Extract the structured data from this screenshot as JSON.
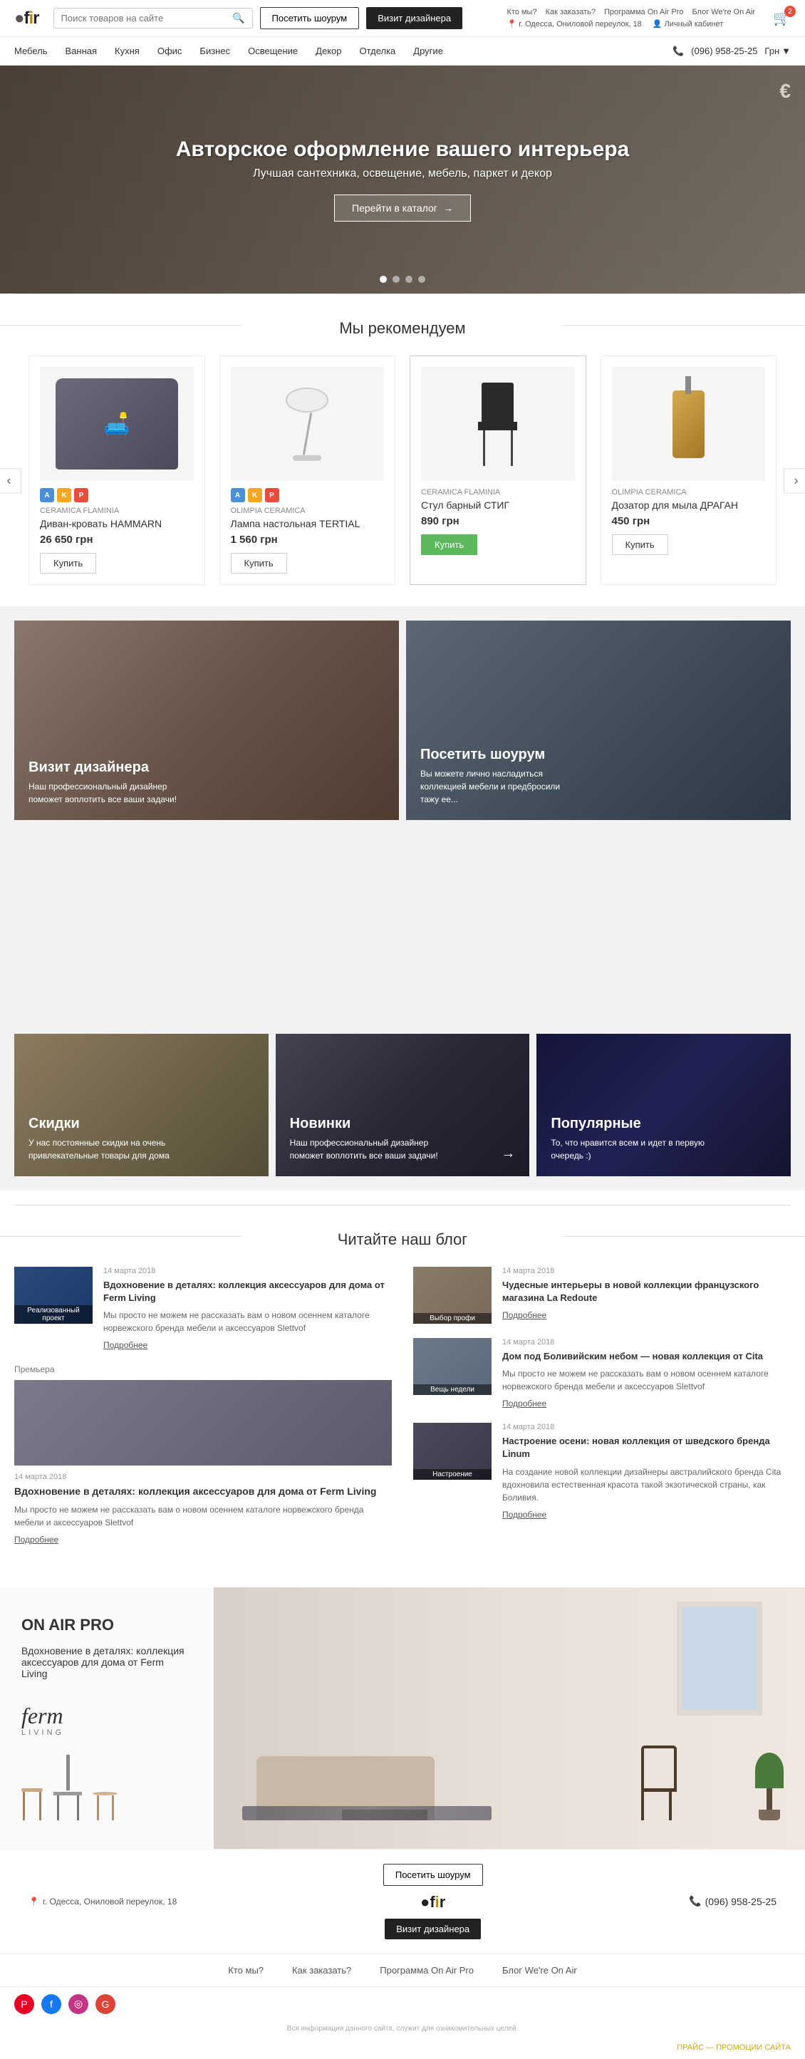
{
  "header": {
    "logo": "efir",
    "search_placeholder": "Поиск товаров на сайте",
    "btn_visit_showroom": "Посетить шоурум",
    "btn_visit_designer": "Визит дизайнера",
    "address": "г. Одесса, Ониловой переулок, 18",
    "personal_cabinet": "Личный кабинет",
    "cart_count": "2",
    "info_links": {
      "who_we_are": "Кто мы?",
      "how_to_order": "Как заказать?",
      "program": "Программа On Air Pro",
      "blog": "Блог We're On Air"
    }
  },
  "nav": {
    "items": [
      {
        "label": "Мебель"
      },
      {
        "label": "Ванная"
      },
      {
        "label": "Кухня"
      },
      {
        "label": "Офис"
      },
      {
        "label": "Бизнес"
      },
      {
        "label": "Освещение"
      },
      {
        "label": "Декор"
      },
      {
        "label": "Отделка"
      },
      {
        "label": "Другие"
      }
    ],
    "phone": "(096) 958-25-25",
    "currency": "Грн"
  },
  "hero": {
    "title": "Авторское оформление вашего интерьера",
    "subtitle": "Лучшая сантехника, освещение, мебель, паркет и декор",
    "btn_catalog": "Перейти в каталог",
    "watermark": "€",
    "dots": 4
  },
  "recommended": {
    "section_title": "Мы рекомендуем",
    "products": [
      {
        "brand": "CERAMICA FLAMINIA",
        "name": "Диван-кровать HAMMARN",
        "price": "26 650 грн",
        "btn": "Купить",
        "badges": [
          "A",
          "K",
          "P"
        ]
      },
      {
        "brand": "Olimpia Ceramica",
        "name": "Лампа настольная TERTIAL",
        "price": "1 560 грн",
        "btn": "Купить",
        "badges": [
          "A",
          "K",
          "P"
        ]
      },
      {
        "brand": "CERAMICA FLAMINIA",
        "name": "Стул барный СТИГ",
        "price": "890 грн",
        "btn": "Купить",
        "btn_style": "green",
        "badges": []
      },
      {
        "brand": "Olimpia Ceramica",
        "name": "Дозатор для мыла ДРАГАН",
        "price": "450 грн",
        "btn": "Купить",
        "badges": []
      }
    ]
  },
  "promo": {
    "cards_main": [
      {
        "title": "Визит дизайнера",
        "desc": "Наш профессиональный дизайнер поможет воплотить все ваши задачи!"
      },
      {
        "title": "Посетить шоурум",
        "desc": "Вы можете лично насладиться коллекцией мебели и предбросили тажу ее..."
      }
    ],
    "cards_bottom": [
      {
        "title": "Скидки",
        "desc": "У нас постоянные скидки на очень привлекательные товары для дома"
      },
      {
        "title": "Новинки",
        "desc": "Наш профессиональный дизайнер поможет воплотить все ваши задачи!",
        "has_arrow": true
      },
      {
        "title": "Популярные",
        "desc": "То, что нравится всем и идет в первую очередь :)"
      }
    ]
  },
  "blog": {
    "section_title": "Читайте наш блог",
    "posts": [
      {
        "date": "14 марта 2018",
        "title": "Вдохновение в деталях: коллекция аксессуаров для дома от Ferm Living",
        "excerpt": "Мы просто не можем не рассказать вам о новом осеннем каталоге норвежского бренда мебели и аксессуаров Slettvof",
        "more": "Подробнее",
        "tag": "Реализованный проект",
        "img_class": "bi-1"
      },
      {
        "date": "14 марта 2018",
        "title": "Чудесные интерьеры в новой коллекции французского магазина La Redoute",
        "excerpt": "",
        "more": "Подробнее",
        "tag": "Выбор профи",
        "img_class": "bi-2"
      },
      {
        "date": "14 марта 2018",
        "title": "Дом под Боливийским небом — новая коллекция от Cita",
        "excerpt": "Мы просто не можем не рассказать вам о новом осеннем каталоге норвежского бренда мебели и аксессуаров Slettvof",
        "more": "Подробнее",
        "tag": "Вещь недели",
        "img_class": "bi-3"
      },
      {
        "date": "14 марта 2018",
        "title": "Настроение осени: новая коллекция от шведского бренда Linum",
        "excerpt": "На создание новой коллекции дизайнеры австралийского бренда Cita вдохновила естественная красота такой экзотической страны, как Боливия.",
        "more": "Подробнее",
        "tag": "Настроение",
        "img_class": "bi-4"
      }
    ],
    "featured": {
      "date": "14 марта 2018",
      "title": "Вдохновение в деталях: коллекция аксессуаров для дома от Ferm Living",
      "excerpt": "Мы просто не можем не рассказать вам о новом осеннем каталоге норвежского бренда мебели и аксессуаров Slettvof",
      "more": "Подробнее",
      "tag": "Премьера",
      "img_class": "bi-5"
    }
  },
  "on_air_pro": {
    "section_tag": "ON AIR PRO",
    "subtitle": "Вдохновение в деталях: коллекция аксессуаров для дома от Ferm Living",
    "brand_name": "ferm",
    "brand_sub": "LIVING",
    "desc": ""
  },
  "footer": {
    "address": "г. Одесса, Ониловой переулок, 18",
    "btn_showroom": "Посетить шоурум",
    "btn_designer": "Визит дизайнера",
    "phone": "(096) 958-25-25",
    "logo": "efir",
    "nav_links": [
      "Кто мы?",
      "Как заказать?",
      "Программа On Air Pro",
      "Блог We're On Air"
    ],
    "disclaimer": "Вся информация данного сайта, служит для ознакомительных целей.",
    "promo_link": "ПРАЙС — ПРОМОЦИИ САЙТА"
  }
}
